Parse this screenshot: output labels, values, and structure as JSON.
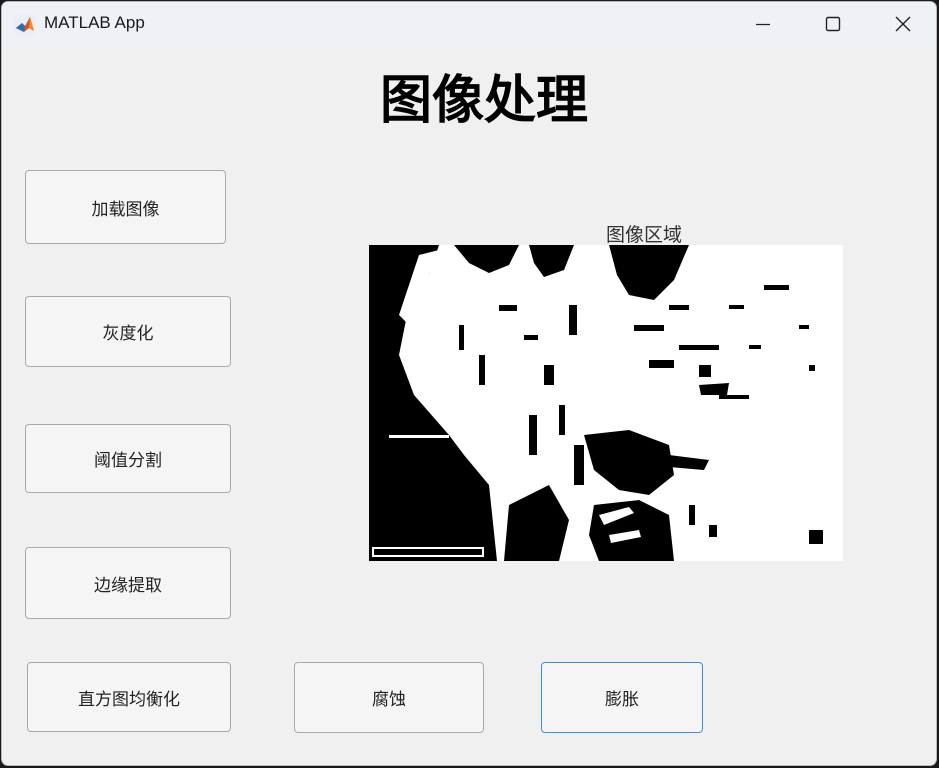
{
  "window": {
    "title": "MATLAB App",
    "icon": "matlab-logo-icon"
  },
  "header": {
    "title": "图像处理"
  },
  "buttons": {
    "load": "加载图像",
    "gray": "灰度化",
    "threshold": "阈值分割",
    "edge": "边缘提取",
    "histeq": "直方图均衡化",
    "erode": "腐蚀",
    "dilate": "膨胀"
  },
  "axes": {
    "title": "图像区域",
    "image_description_colors": {
      "foreground": "#ffffff",
      "background": "#000000"
    }
  },
  "colors": {
    "window_bg": "#f0f0f0",
    "titlebar_bg": "#eef1f6",
    "focus_border": "#3d8ee0"
  }
}
